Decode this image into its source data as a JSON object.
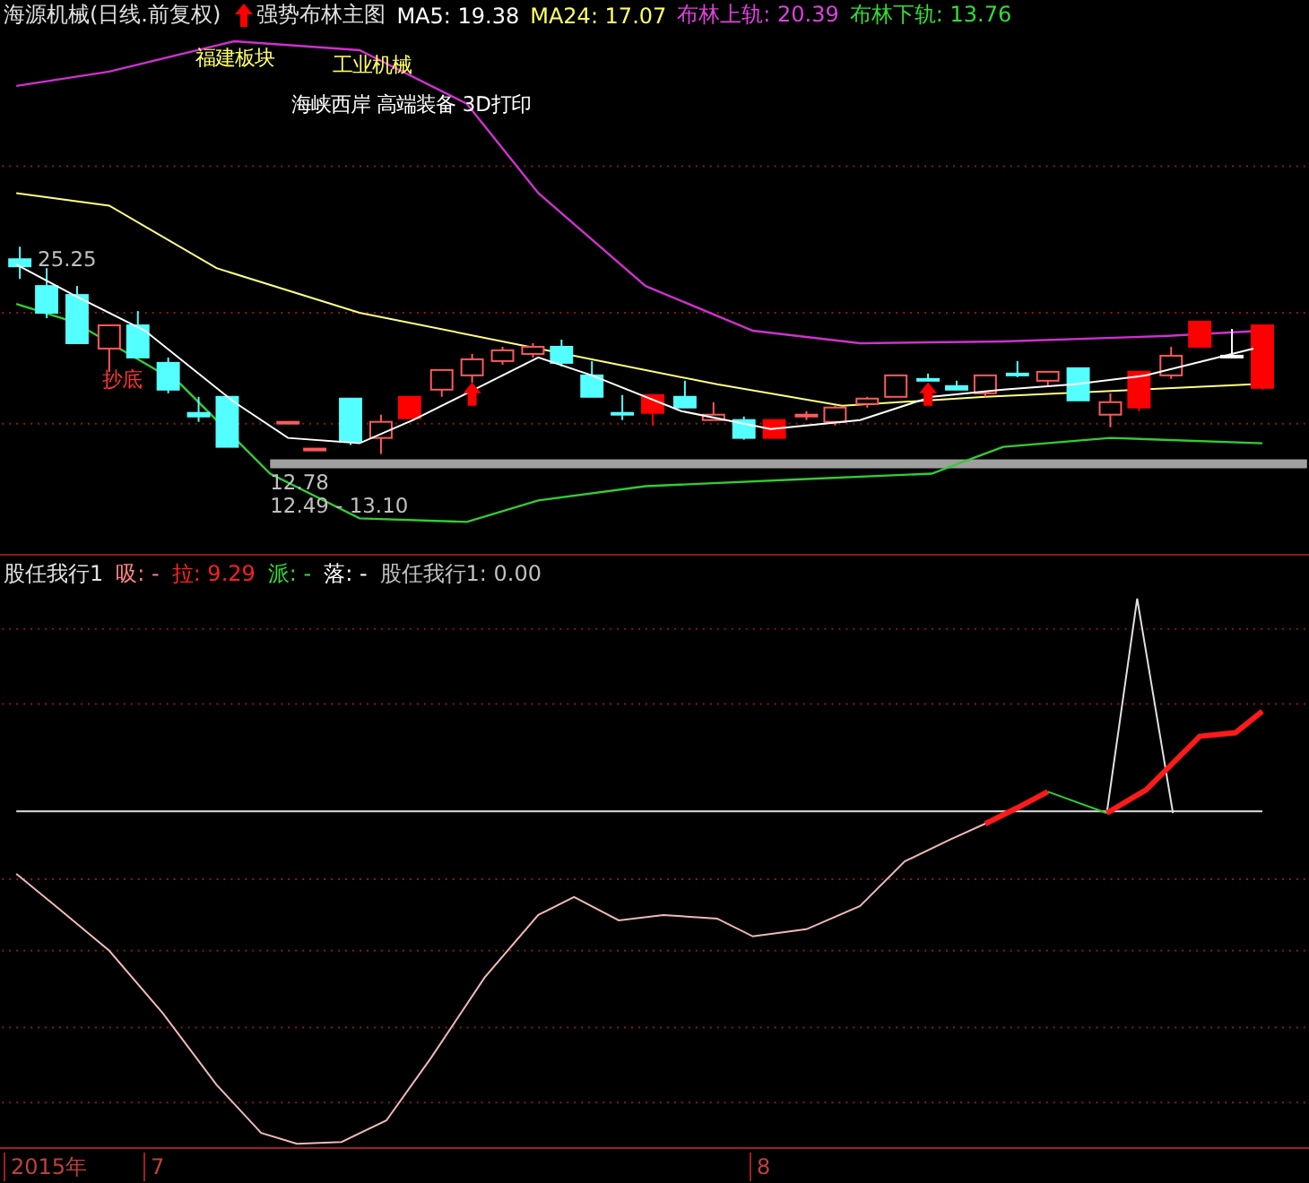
{
  "header": {
    "title": "海源机械(日线.前复权)",
    "indicator": "强势布林主图",
    "values": [
      {
        "label": "MA5: 19.38",
        "color": "#ffffff"
      },
      {
        "label": "MA24: 17.07",
        "color": "#ffff66"
      },
      {
        "label": "布林上轨: 20.39",
        "color": "#e040e0"
      },
      {
        "label": "布林下轨: 13.76",
        "color": "#33dd33"
      }
    ]
  },
  "main_chart": {
    "annotations": [
      {
        "text": "福建板块",
        "color": "#ffff66"
      },
      {
        "text": "工业机械",
        "color": "#ffff66"
      },
      {
        "text": "海峡西岸 高端装备 3D打印",
        "color": "#ffffff"
      },
      {
        "text": "25.25",
        "color": "#c0c0c0"
      },
      {
        "text": "抄底",
        "color": "#ff3333"
      },
      {
        "text": "12.78",
        "color": "#c0c0c0"
      },
      {
        "text": "12.49 - 13.10",
        "color": "#c0c0c0"
      }
    ]
  },
  "indicator_header": {
    "title": "股任我行1",
    "values": [
      {
        "label": "吸: -",
        "color": "#ff8080"
      },
      {
        "label": "拉: 9.29",
        "color": "#ff2020"
      },
      {
        "label": "派: -",
        "color": "#33dd33"
      },
      {
        "label": "落: -",
        "color": "#ffffff"
      },
      {
        "label": "股任我行1: 0.00",
        "color": "#c0c0c0"
      }
    ]
  },
  "time_axis": {
    "labels": [
      "2015年",
      "7",
      "8"
    ]
  }
}
